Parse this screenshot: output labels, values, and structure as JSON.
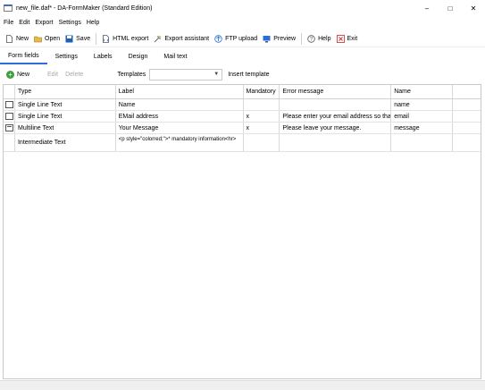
{
  "window": {
    "title": "new_file.daf* - DA-FormMaker (Standard Edition)",
    "controls": [
      "–",
      "□",
      "✕"
    ]
  },
  "menu": [
    "File",
    "Edit",
    "Export",
    "Settings",
    "Help"
  ],
  "toolbar": {
    "new": "New",
    "open": "Open",
    "save": "Save",
    "html_export": "HTML export",
    "export_assistant": "Export assistant",
    "ftp_upload": "FTP upload",
    "preview": "Preview",
    "help": "Help",
    "exit": "Exit"
  },
  "tabs": [
    "Form fields",
    "Settings",
    "Labels",
    "Design",
    "Mail text"
  ],
  "active_tab": "Form fields",
  "subtoolbar": {
    "new": "New",
    "edit": "Edit",
    "delete": "Delete",
    "templates_label": "Templates",
    "templates_value": "",
    "insert_template": "Insert template"
  },
  "grid": {
    "columns": [
      "Type",
      "Label",
      "Mandatory",
      "Error message",
      "Name"
    ],
    "rows": [
      {
        "icon": "single-line-icon",
        "type": "Single Line Text",
        "label": "Name",
        "mandatory": "",
        "error": "",
        "name": "name"
      },
      {
        "icon": "single-line-icon",
        "type": "Single Line Text",
        "label": "EMail address",
        "mandatory": "x",
        "error": "Please enter your email address so that v",
        "name": "email"
      },
      {
        "icon": "multiline-icon",
        "type": "Multiline Text",
        "label": "Your Message",
        "mandatory": "x",
        "error": "Please leave your message.",
        "name": "message"
      },
      {
        "icon": "intermediate-icon",
        "type": "Intermediate Text",
        "label": "<p style=\"colorred;\">* mandatory information<hr>",
        "mandatory": "",
        "error": "",
        "name": ""
      }
    ]
  },
  "colors": {
    "tab_accent": "#2a6ed6",
    "new_icon": "#3f9f3f",
    "save_icon": "#1f5fb3",
    "exit_icon": "#c62828"
  }
}
